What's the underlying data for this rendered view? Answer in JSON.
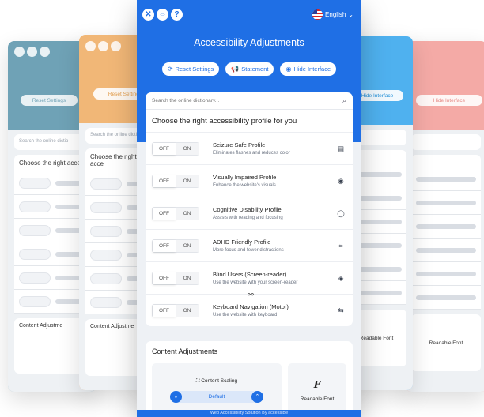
{
  "window": {
    "title": "Accessibility Adjustments"
  },
  "topbar": {
    "close_icon": "close-icon",
    "move_icon": "move-icon",
    "help_icon": "help-icon",
    "language": "English"
  },
  "buttons": {
    "reset": "Reset Settings",
    "statement": "Statement",
    "hide": "Hide Interface"
  },
  "search": {
    "placeholder": "Search the online dictionary..."
  },
  "profiles": {
    "heading": "Choose the right accessibility profile for you",
    "toggle_off": "OFF",
    "toggle_on": "ON",
    "items": [
      {
        "name": "Seizure Safe Profile",
        "desc": "Eliminates flashes and reduces color",
        "icon": "flash-off-icon",
        "state": "off"
      },
      {
        "name": "Visually Impaired Profile",
        "desc": "Enhance the website's visuals",
        "icon": "eye-icon",
        "state": "off"
      },
      {
        "name": "Cognitive Disability Profile",
        "desc": "Assists with reading and focusing",
        "icon": "target-icon",
        "state": "off"
      },
      {
        "name": "ADHD Friendly Profile",
        "desc": "More focus and fewer distractions",
        "icon": "focus-icon",
        "state": "off"
      },
      {
        "name": "Blind Users (Screen-reader)",
        "desc": "Use the website with your screen-reader",
        "icon": "audio-icon",
        "state": "off"
      },
      {
        "name": "Keyboard Navigation (Motor)",
        "desc": "Use the website with keyboard",
        "icon": "arrows-icon",
        "state": "off"
      }
    ]
  },
  "content_adjustments": {
    "title": "Content Adjustments",
    "scaling_label": "Content Scaling",
    "scaling_value": "Default",
    "readable_font_label": "Readable Font"
  },
  "footer": {
    "text": "Web Accessibility Solution By accessiBe"
  },
  "background_panels": {
    "reset_label": "Reset Settings",
    "hide_label": "Hide Interface",
    "choose_prefix": "Choose the right acce",
    "search_prefix": "Search the online dictio",
    "content_prefix": "Content Adjustme"
  },
  "colors": {
    "main_accent": "#1f6fe5",
    "panel_teal": "#6fa2b6",
    "panel_orange": "#f1b777",
    "panel_sky": "#4fb1ef",
    "panel_pink": "#f4aaa6"
  }
}
